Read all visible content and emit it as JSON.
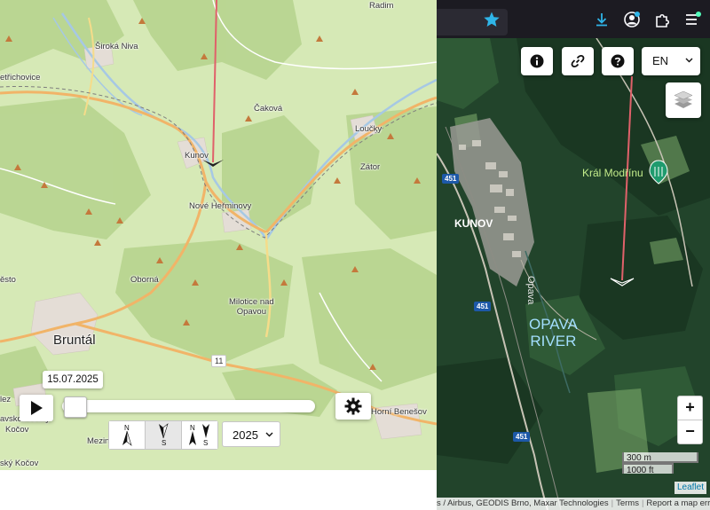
{
  "street_map": {
    "places": {
      "radim": "Radim",
      "siroka_niva": "Široká Niva",
      "petrichovice": "etřichovice",
      "cakova": "Čaková",
      "loucky": "Loučky",
      "kunov": "Kunov",
      "zator": "Zátor",
      "nove_herminovy": "Nové Heřminovy",
      "oborna": "Oborná",
      "milotice": "Milotice nad\nOpavou",
      "bruntal": "Bruntál",
      "lesto": "ěsto",
      "slez": "lez",
      "avskoslezsky": "avskoslezský",
      "kocov": "Kočov",
      "sky_kocov": "ský Kočov",
      "mezin": "Mezin",
      "horni_benesov": "Horní Benešov"
    },
    "road_label": "11"
  },
  "timeline": {
    "date": "15.07.2025",
    "year": "2025",
    "position": 0.0,
    "orientation_labels": {
      "north": "N",
      "south": "S",
      "both_n": "N",
      "both_s": "S"
    }
  },
  "satellite_map": {
    "lang": "EN",
    "labels": {
      "kral_modrinu": "Král Modřínu",
      "kunov": "KUNOV",
      "opava": "Opava",
      "opava_river": "OPAVA\nRIVER"
    },
    "road_shields": [
      "451",
      "451",
      "451"
    ],
    "zoom_in": "+",
    "zoom_out": "−",
    "scale": {
      "metric": "300 m",
      "imperial": "1000 ft"
    },
    "leaflet": "Leaflet",
    "attribution": "s / Airbus, GEODIS Brno, Maxar Technologies",
    "terms": "Terms",
    "report": "Report a map error"
  },
  "colors": {
    "accent_blue": "#2fb5e8",
    "route_red": "#e0616a",
    "poi_green": "#1f9b6e",
    "satellite_label": "#a3dfff",
    "forest_dark": "#23452b"
  },
  "icons": {
    "info": "info-icon",
    "link": "link-icon",
    "help": "help-icon",
    "layers": "layers-icon",
    "play": "play-icon",
    "settings": "gear-icon",
    "star": "star-icon",
    "download": "download-icon",
    "account": "account-icon",
    "extensions": "puzzle-icon",
    "menu": "menu-icon"
  }
}
